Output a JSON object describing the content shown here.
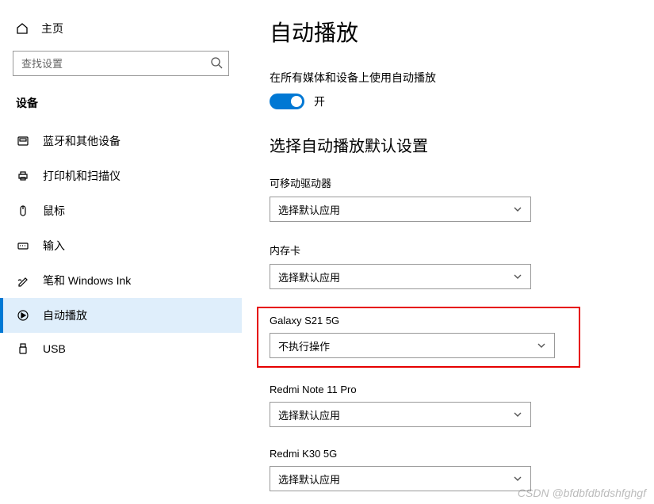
{
  "sidebar": {
    "home": "主页",
    "search_placeholder": "查找设置",
    "section": "设备",
    "items": [
      {
        "label": "蓝牙和其他设备"
      },
      {
        "label": "打印机和扫描仪"
      },
      {
        "label": "鼠标"
      },
      {
        "label": "输入"
      },
      {
        "label": "笔和 Windows Ink"
      },
      {
        "label": "自动播放"
      },
      {
        "label": "USB"
      }
    ]
  },
  "main": {
    "title": "自动播放",
    "toggle_text": "在所有媒体和设备上使用自动播放",
    "toggle_state": "开",
    "section_title": "选择自动播放默认设置",
    "devices": [
      {
        "label": "可移动驱动器",
        "value": "选择默认应用",
        "highlight": false
      },
      {
        "label": "内存卡",
        "value": "选择默认应用",
        "highlight": false
      },
      {
        "label": "Galaxy S21 5G",
        "value": "不执行操作",
        "highlight": true
      },
      {
        "label": "Redmi Note 11 Pro",
        "value": "选择默认应用",
        "highlight": false
      },
      {
        "label": "Redmi K30 5G",
        "value": "选择默认应用",
        "highlight": false
      }
    ]
  },
  "watermark": "CSDN @bfdbfdbfdshfghgf"
}
